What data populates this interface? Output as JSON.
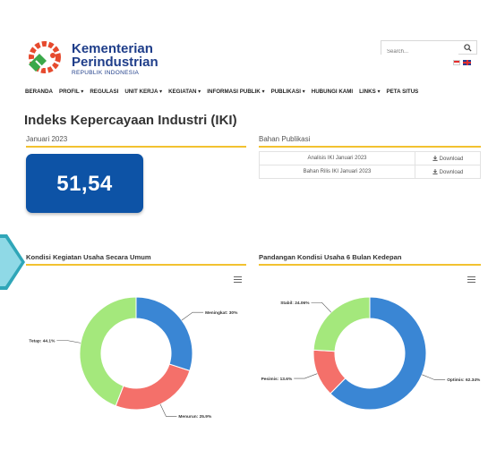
{
  "brand": {
    "line1": "Kementerian",
    "line2": "Perindustrian",
    "line3": "REPUBLIK INDONESIA"
  },
  "search": {
    "placeholder": "Search..."
  },
  "nav": {
    "items": [
      "BERANDA",
      "PROFIL ▾",
      "REGULASI",
      "UNIT KERJA ▾",
      "KEGIATAN ▾",
      "INFORMASI PUBLIK ▾",
      "PUBLIKASI ▾",
      "HUBUNGI KAMI",
      "LINKS ▾",
      "PETA SITUS"
    ]
  },
  "page": {
    "title": "Indeks Kepercayaan Industri (IKI)"
  },
  "iki": {
    "period": "Januari 2023",
    "value": "51,54"
  },
  "publikasi": {
    "heading": "Bahan Publikasi",
    "rows": [
      {
        "name": "Analisis IKI Januari 2023",
        "action": "Download"
      },
      {
        "name": "Bahan Rilis IKI Januari 2023",
        "action": "Download"
      }
    ]
  },
  "colors": {
    "brand_blue": "#0d53a6",
    "accent": "#f2c230",
    "blue": "#3a86d4",
    "red": "#f4706a",
    "green": "#a4e87c"
  },
  "chart_data": [
    {
      "type": "pie",
      "title": "Kondisi Kegiatan Usaha Secara Umum",
      "categories": [
        "Meningkat",
        "Menurun",
        "Tetap"
      ],
      "values": [
        30,
        25.9,
        44.1
      ],
      "labels": [
        "Meningkat: 30%",
        "Menurun: 25.9%",
        "Tetap: 44.1%"
      ],
      "colors": [
        "#3a86d4",
        "#f4706a",
        "#a4e87c"
      ]
    },
    {
      "type": "pie",
      "title": "Pandangan Kondisi Usaha 6 Bulan Kedepan",
      "categories": [
        "Optimis",
        "Pesimis",
        "Stabil"
      ],
      "values": [
        62.34,
        13.6,
        24.06
      ],
      "labels": [
        "Optimis: 62.34%",
        "Pesimis: 13.6%",
        "Stabil: 24.06%"
      ],
      "colors": [
        "#3a86d4",
        "#f4706a",
        "#a4e87c"
      ]
    }
  ]
}
